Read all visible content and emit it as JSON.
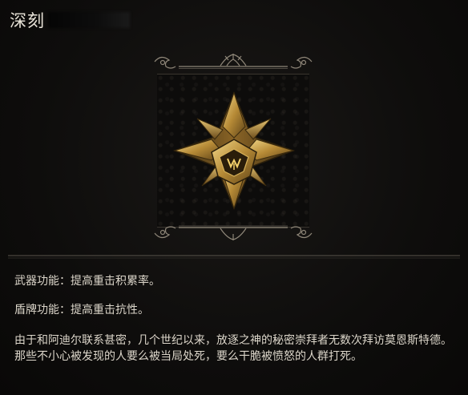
{
  "title": "深刻",
  "item_icon": "golden-star-emblem-icon",
  "descriptions": {
    "weapon": "武器功能：提高重击积累率。",
    "shield": "盾牌功能：提高重击抗性。",
    "lore": "由于和阿迪尔联系甚密，几个世纪以来，放逐之神的秘密崇拜者无数次拜访莫恩斯特德。那些不小心被发现的人要么被当局处死，要么干脆被愤怒的人群打死。"
  },
  "colors": {
    "background": "#0b0a09",
    "text": "#dcd6ca",
    "gold": "#c8a04a",
    "ornament": "#8e8678"
  }
}
